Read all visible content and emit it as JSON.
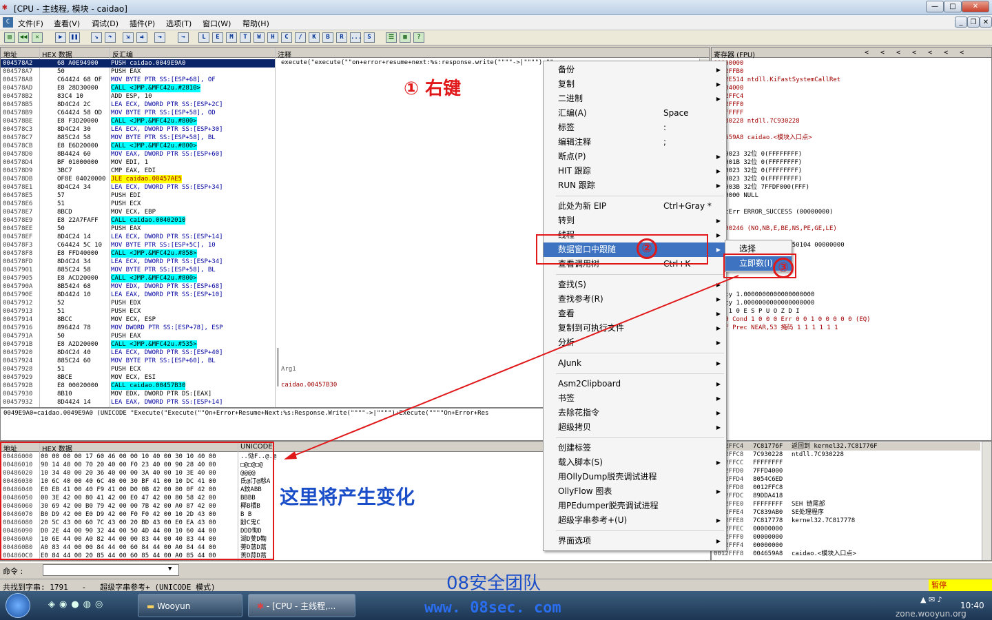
{
  "window": {
    "title": "[CPU - 主线程, 模块 - caidao]",
    "btn_min": "—",
    "btn_max": "□",
    "btn_close": "✕"
  },
  "menubar": {
    "items": [
      "文件(F)",
      "查看(V)",
      "调试(D)",
      "插件(P)",
      "选项(T)",
      "窗口(W)",
      "帮助(H)"
    ],
    "mdi_min": "_",
    "mdi_restore": "❐",
    "mdi_close": "✕"
  },
  "toolbar": {
    "letter_buttons": [
      "L",
      "E",
      "M",
      "T",
      "W",
      "H",
      "C",
      "/",
      "K",
      "B",
      "R",
      "...",
      "S"
    ]
  },
  "disasm": {
    "headers": {
      "addr": "地址",
      "hex": "HEX 数据",
      "dis": "反汇编",
      "comment": "注释"
    },
    "rows": [
      {
        "a": "004578A2",
        "h": "68 A0E94900",
        "d": "PUSH caidao.0049E9A0",
        "t": "sel"
      },
      {
        "a": "004578A7",
        "h": "50",
        "d": "PUSH EAX"
      },
      {
        "a": "004578A8",
        "h": "C64424 68 OF",
        "d": "MOV BYTE PTR SS:[ESP+68], OF",
        "t": "cy"
      },
      {
        "a": "004578AD",
        "h": "E8 28D30000",
        "d": "CALL <JMP.&MFC42u.#2810>",
        "t": "call"
      },
      {
        "a": "004578B2",
        "h": "83C4 10",
        "d": "ADD ESP, 10"
      },
      {
        "a": "004578B5",
        "h": "8D4C24 2C",
        "d": "LEA ECX, DWORD PTR SS:[ESP+2C]",
        "t": "cy"
      },
      {
        "a": "004578B9",
        "h": "C64424 58 OD",
        "d": "MOV BYTE PTR SS:[ESP+58], OD",
        "t": "cy"
      },
      {
        "a": "004578BE",
        "h": "E8 F3D20000",
        "d": "CALL <JMP.&MFC42u.#800>",
        "t": "call"
      },
      {
        "a": "004578C3",
        "h": "8D4C24 30",
        "d": "LEA ECX, DWORD PTR SS:[ESP+30]",
        "t": "cy"
      },
      {
        "a": "004578C7",
        "h": "885C24 58",
        "d": "MOV BYTE PTR SS:[ESP+58], BL",
        "t": "cy"
      },
      {
        "a": "004578CB",
        "h": "E8 E6D20000",
        "d": "CALL <JMP.&MFC42u.#800>",
        "t": "call"
      },
      {
        "a": "004578D0",
        "h": "8B4424 60",
        "d": "MOV EAX, DWORD PTR SS:[ESP+60]",
        "t": "cy"
      },
      {
        "a": "004578D4",
        "h": "BF 01000000",
        "d": "MOV EDI, 1"
      },
      {
        "a": "004578D9",
        "h": "3BC7",
        "d": "CMP EAX, EDI"
      },
      {
        "a": "004578DB",
        "h": "OF8E 04020000",
        "d": "JLE caidao.00457AE5",
        "t": "ye"
      },
      {
        "a": "004578E1",
        "h": "8D4C24 34",
        "d": "LEA ECX, DWORD PTR SS:[ESP+34]",
        "t": "cy"
      },
      {
        "a": "004578E5",
        "h": "57",
        "d": "PUSH EDI"
      },
      {
        "a": "004578E6",
        "h": "51",
        "d": "PUSH ECX"
      },
      {
        "a": "004578E7",
        "h": "8BCD",
        "d": "MOV ECX, EBP"
      },
      {
        "a": "004578E9",
        "h": "E8 22A7FAFF",
        "d": "CALL caidao.00402010",
        "t": "call"
      },
      {
        "a": "004578EE",
        "h": "50",
        "d": "PUSH EAX"
      },
      {
        "a": "004578EF",
        "h": "8D4C24 14",
        "d": "LEA ECX, DWORD PTR SS:[ESP+14]",
        "t": "cy"
      },
      {
        "a": "004578F3",
        "h": "C64424 5C 10",
        "d": "MOV BYTE PTR SS:[ESP+5C], 10",
        "t": "cy"
      },
      {
        "a": "004578F8",
        "h": "E8 FFD40000",
        "d": "CALL <JMP.&MFC42u.#858>",
        "t": "call"
      },
      {
        "a": "004578FD",
        "h": "8D4C24 34",
        "d": "LEA ECX, DWORD PTR SS:[ESP+34]",
        "t": "cy"
      },
      {
        "a": "00457901",
        "h": "885C24 58",
        "d": "MOV BYTE PTR SS:[ESP+58], BL",
        "t": "cy"
      },
      {
        "a": "00457905",
        "h": "E8 ACD20000",
        "d": "CALL <JMP.&MFC42u.#800>",
        "t": "call"
      },
      {
        "a": "0045790A",
        "h": "8B5424 68",
        "d": "MOV EDX, DWORD PTR SS:[ESP+68]",
        "t": "cy"
      },
      {
        "a": "0045790E",
        "h": "8D4424 10",
        "d": "LEA EAX, DWORD PTR SS:[ESP+10]",
        "t": "cy"
      },
      {
        "a": "00457912",
        "h": "52",
        "d": "PUSH EDX"
      },
      {
        "a": "00457913",
        "h": "51",
        "d": "PUSH ECX"
      },
      {
        "a": "00457914",
        "h": "8BCC",
        "d": "MOV ECX, ESP"
      },
      {
        "a": "00457916",
        "h": "896424 78",
        "d": "MOV DWORD PTR SS:[ESP+78], ESP",
        "t": "cy"
      },
      {
        "a": "0045791A",
        "h": "50",
        "d": "PUSH EAX"
      },
      {
        "a": "0045791B",
        "h": "E8 A2D20000",
        "d": "CALL <JMP.&MFC42u.#535>",
        "t": "call"
      },
      {
        "a": "00457920",
        "h": "8D4C24 40",
        "d": "LEA ECX, DWORD PTR SS:[ESP+40]",
        "t": "cy"
      },
      {
        "a": "00457924",
        "h": "885C24 60",
        "d": "MOV BYTE PTR SS:[ESP+60], BL",
        "t": "cy"
      },
      {
        "a": "00457928",
        "h": "51",
        "d": "PUSH ECX"
      },
      {
        "a": "00457929",
        "h": "8BCE",
        "d": "MOV ECX, ESI"
      },
      {
        "a": "0045792B",
        "h": "E8 00020000",
        "d": "CALL caidao.00457B30",
        "t": "call"
      },
      {
        "a": "00457930",
        "h": "8B10",
        "d": "MOV EDX, DWORD PTR DS:[EAX]"
      },
      {
        "a": "00457932",
        "h": "8D4424 14",
        "d": "LEA EAX, DWORD PTR SS:[ESP+14]",
        "t": "cy"
      }
    ],
    "comment_top": "execute(\"execute(\"\"on+error+resume+next:%s:response.write(\"\"\"\"->|\"\"\"\"):\"\"",
    "comment_arg": "Arg1",
    "comment_call": "caidao.00457B30",
    "info_line": "0049E9A0=caidao.0049E9A0 (UNICODE \"Execute(\"Execute(\"\"On+Error+Resume+Next:%s:Response.Write(\"\"\"\"->|\"\"\"\"):Execute(\"\"\"\"On+Error+Res"
  },
  "registers": {
    "title": "寄存器 (FPU)",
    "lines": [
      "00000000",
      "0012FFB0",
      "7C92E514 ntdll.KiFastSystemCallRet",
      "7FFD4000",
      "0012FFC4",
      "0012FFF0",
      "FFFFFFFF",
      "7C930228 ntdll.7C930228",
      "",
      "004659A8 caidao.<模块入口点>",
      "",
      " ES 0023 32位 0(FFFFFFFF)",
      " CS 001B 32位 0(FFFFFFFF)",
      " SS 0023 32位 0(FFFFFFFF)",
      " DS 0023 32位 0(FFFFFFFF)",
      " FS 003B 32位 7FFDF000(FFF)",
      " GS 0000 NULL",
      "",
      " LastErr ERROR_SUCCESS (00000000)",
      "",
      "00000246 (NO,NB,E,BE,NS,PE,GE,LE)",
      "",
      "empty -UNORM BCE0 01050104 00000000",
      "empty 0.0",
      "",
      "",
      "",
      "",
      "empty 1.0000000000000000000",
      "empty 1.0000000000000000000",
      "          3 2 1 0      E S P U O Z D I",
      "4020  Cond 1 0 0 0  Err 0 0 1 0 0 0 0 0  (EQ)",
      "027F  Prec NEAR,53  掩码    1 1 1 1 1 1"
    ]
  },
  "dump": {
    "headers": {
      "addr": "地址",
      "hex": "HEX 数据",
      "uni": "UNICODE"
    },
    "rows": [
      {
        "a": "00486000",
        "h": "00 00 00 00 17 60 46 00 00 10 40 00 30 10 40 00",
        "u": "..恸F..@.@"
      },
      {
        "a": "00486010",
        "h": "90 14 40 00 70 20 40 00 F0 23 40 00 90 28 40 00",
        "u": "□@□@□@"
      },
      {
        "a": "00486020",
        "h": "10 34 40 00 20 36 40 00 00 3A 40 00 10 3E 40 00",
        "u": "@@@@"
      },
      {
        "a": "00486030",
        "h": "10 6C 40 00 40 6C 40 00 30 BF 41 00 10 DC 41 00",
        "u": "氐@汀@慤A"
      },
      {
        "a": "00486040",
        "h": "E0 EB 41 00 40 F9 41 00 D0 0B 42 00 80 0F 42 00",
        "u": "A鈫ABB"
      },
      {
        "a": "00486050",
        "h": "00 3E 42 00 80 41 42 00 E0 47 42 00 80 58 42 00",
        "u": "BBBB"
      },
      {
        "a": "00486060",
        "h": "30 69 42 00 B0 79 42 00 00 7B 42 00 A0 87 42 00",
        "u": "椰B樌B"
      },
      {
        "a": "00486070",
        "h": "B0 D9 42 00 E0 D9 42 00 F0 F0 42 00 10 2D 43 00",
        "u": "B B"
      },
      {
        "a": "00486080",
        "h": "20 5C 43 00 60 7C 43 00 20 BD 43 00 E0 EA 43 00",
        "u": "鼢C鬼C"
      },
      {
        "a": "00486090",
        "h": "D0 2E 44 00 90 32 44 00 50 4D 44 00 10 60 44 00",
        "u": "DDD恂D"
      },
      {
        "a": "004860A0",
        "h": "10 6E 44 00 A0 82 44 00 00 83 44 00 40 83 44 00",
        "u": "湖D芰D鞠"
      },
      {
        "a": "004860B0",
        "h": "A0 83 44 00 00 84 44 00 60 84 44 00 A0 84 44 00",
        "u": "蒡D蒎D蒚"
      },
      {
        "a": "004860C0",
        "h": "E0 84 44 00 20 85 44 00 60 85 44 00 A0 85 44 00",
        "u": "蒉D蒜D蒚"
      }
    ]
  },
  "stack": {
    "rows": [
      {
        "a": "0012FFC4",
        "v": "7C81776F",
        "c": "返回到 kernel32.7C81776F"
      },
      {
        "a": "0012FFC8",
        "v": "7C930228",
        "c": "ntdll.7C930228"
      },
      {
        "a": "0012FFCC",
        "v": "FFFFFFFF",
        "c": ""
      },
      {
        "a": "0012FFD0",
        "v": "7FFD4000",
        "c": ""
      },
      {
        "a": "0012FFD4",
        "v": "8054C6ED",
        "c": ""
      },
      {
        "a": "0012FFD8",
        "v": "0012FFC8",
        "c": ""
      },
      {
        "a": "0012FFDC",
        "v": "89DDA418",
        "c": ""
      },
      {
        "a": "0012FFE0",
        "v": "FFFFFFFF",
        "c": "SEH 链尾部"
      },
      {
        "a": "0012FFE4",
        "v": "7C839AB0",
        "c": "SE处理程序"
      },
      {
        "a": "0012FFE8",
        "v": "7C817778",
        "c": "kernel32.7C817778"
      },
      {
        "a": "0012FFEC",
        "v": "00000000",
        "c": ""
      },
      {
        "a": "0012FFF0",
        "v": "00000000",
        "c": ""
      },
      {
        "a": "0012FFF4",
        "v": "00000000",
        "c": ""
      },
      {
        "a": "0012FFF8",
        "v": "004659A8",
        "c": "caidao.<模块入口点>"
      }
    ]
  },
  "context_menu": {
    "items": [
      {
        "l": "备份",
        "k": "",
        "s": 1
      },
      {
        "l": "复制",
        "k": "",
        "s": 1
      },
      {
        "l": "二进制",
        "k": "",
        "s": 1
      },
      {
        "l": "汇编(A)",
        "k": "Space",
        "s": 0
      },
      {
        "l": "标签",
        "k": ":",
        "s": 0
      },
      {
        "l": "编辑注释",
        "k": ";",
        "s": 0
      },
      {
        "l": "断点(P)",
        "k": "",
        "s": 1
      },
      {
        "l": "HIT 跟踪",
        "k": "",
        "s": 1
      },
      {
        "l": "RUN 跟踪",
        "k": "",
        "s": 1
      },
      {
        "sep": 1
      },
      {
        "l": "此处为新 EIP",
        "k": "Ctrl+Gray *",
        "s": 0
      },
      {
        "l": "转到",
        "k": "",
        "s": 1
      },
      {
        "l": "线程",
        "k": "",
        "s": 1
      },
      {
        "l": "数据窗口中跟随",
        "k": "",
        "s": 1,
        "on": 1
      },
      {
        "l": "查看调用树",
        "k": "Ctrl+K",
        "s": 0
      },
      {
        "sep": 1
      },
      {
        "l": "查找(S)",
        "k": "",
        "s": 1
      },
      {
        "l": "查找参考(R)",
        "k": "",
        "s": 1
      },
      {
        "l": "查看",
        "k": "",
        "s": 1
      },
      {
        "l": "复制到可执行文件",
        "k": "",
        "s": 1
      },
      {
        "l": "分析",
        "k": "",
        "s": 1
      },
      {
        "sep": 1
      },
      {
        "l": "AJunk",
        "k": "",
        "s": 1
      },
      {
        "sep": 1
      },
      {
        "l": "Asm2Clipboard",
        "k": "",
        "s": 1
      },
      {
        "l": "书签",
        "k": "",
        "s": 1
      },
      {
        "l": "去除花指令",
        "k": "",
        "s": 1
      },
      {
        "l": "超级拷贝",
        "k": "",
        "s": 1
      },
      {
        "sep": 1
      },
      {
        "l": "创建标签",
        "k": "",
        "s": 0
      },
      {
        "l": "载入脚本(S)",
        "k": "",
        "s": 1
      },
      {
        "l": "用OllyDump脱壳调试进程",
        "k": "",
        "s": 0
      },
      {
        "l": "OllyFlow 图表",
        "k": "",
        "s": 1
      },
      {
        "l": "用PEdumper脱壳调试进程",
        "k": "",
        "s": 0
      },
      {
        "l": "超级字串参考+(U)",
        "k": "",
        "s": 1
      },
      {
        "sep": 1
      },
      {
        "l": "界面选项",
        "k": "",
        "s": 1
      }
    ],
    "submenu": [
      "选择",
      "立即数(I)"
    ]
  },
  "annotations": {
    "step1": "① 右键",
    "n2": "②",
    "n3": "③",
    "change": "这里将产生变化",
    "team": "08安全团队",
    "site": "www. 08sec. com"
  },
  "command": {
    "label": "命令 :"
  },
  "status": {
    "text": "共找到字串: 1791   -   超级字串参考+ (UNICODE 模式)",
    "state": "暂停"
  },
  "taskbar": {
    "task1": "Wooyun",
    "task2": "- [CPU - 主线程,...",
    "time": "10:40",
    "watermark": "zone.wooyun.org"
  }
}
